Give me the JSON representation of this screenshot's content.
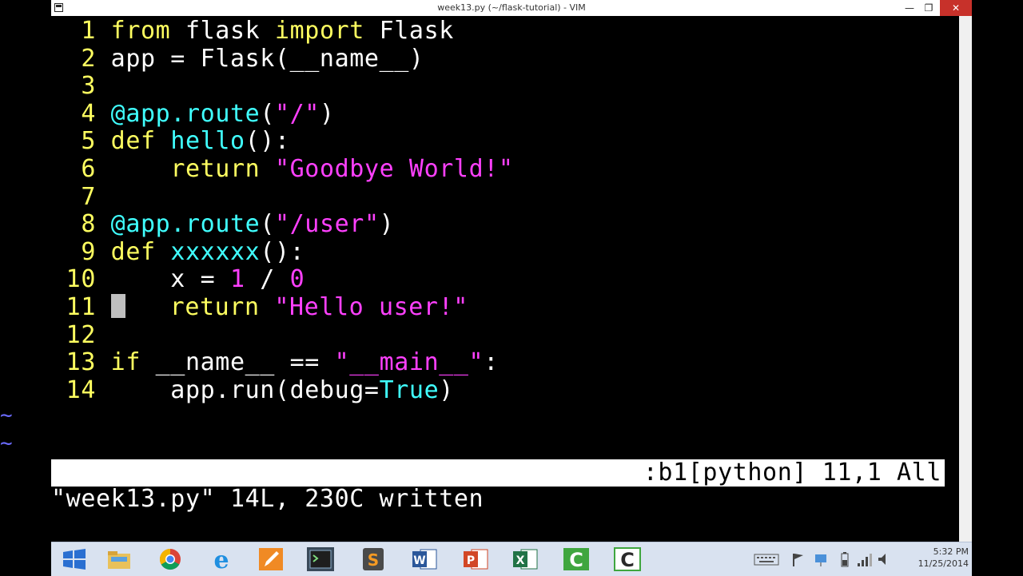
{
  "window": {
    "title": "week13.py (~/flask-tutorial) - VIM",
    "min_label": "—",
    "max_label": "❐",
    "close_label": "✕"
  },
  "code_lines": [
    {
      "n": "1",
      "text": "from flask import Flask"
    },
    {
      "n": "2",
      "text": "app = Flask(__name__)"
    },
    {
      "n": "3",
      "text": ""
    },
    {
      "n": "4",
      "text": "@app.route(\"/\")"
    },
    {
      "n": "5",
      "text": "def hello():"
    },
    {
      "n": "6",
      "text": "    return \"Goodbye World!\""
    },
    {
      "n": "7",
      "text": ""
    },
    {
      "n": "8",
      "text": "@app.route(\"/user\")"
    },
    {
      "n": "9",
      "text": "def xxxxxx():"
    },
    {
      "n": "10",
      "text": "    x = 1 / 0"
    },
    {
      "n": "11",
      "text": "    return \"Hello user!\""
    },
    {
      "n": "12",
      "text": ""
    },
    {
      "n": "13",
      "text": "if __name__ == \"__main__\":"
    },
    {
      "n": "14",
      "text": "    app.run(debug=True)"
    }
  ],
  "tildes": [
    "~",
    "~"
  ],
  "status": {
    "filename": "week13.py",
    "info": ":b1[python] 11,1 All"
  },
  "message": "\"week13.py\" 14L, 230C written",
  "clock": {
    "time": "5:32 PM",
    "date": "11/25/2014"
  },
  "colors": {
    "line_number": "#ffff60",
    "keyword": "#ffff60",
    "string": "#ff40ff",
    "function": "#40ffff",
    "text": "#ffffff",
    "tilde": "#6b6bff"
  },
  "taskbar_icons": [
    "windows-start-icon",
    "file-explorer-icon",
    "chrome-icon",
    "internet-explorer-icon",
    "pencil-app-icon",
    "terminal-icon",
    "sublime-text-icon",
    "word-icon",
    "powerpoint-icon",
    "excel-icon",
    "camtasia-icon",
    "camtasia-recorder-icon"
  ]
}
